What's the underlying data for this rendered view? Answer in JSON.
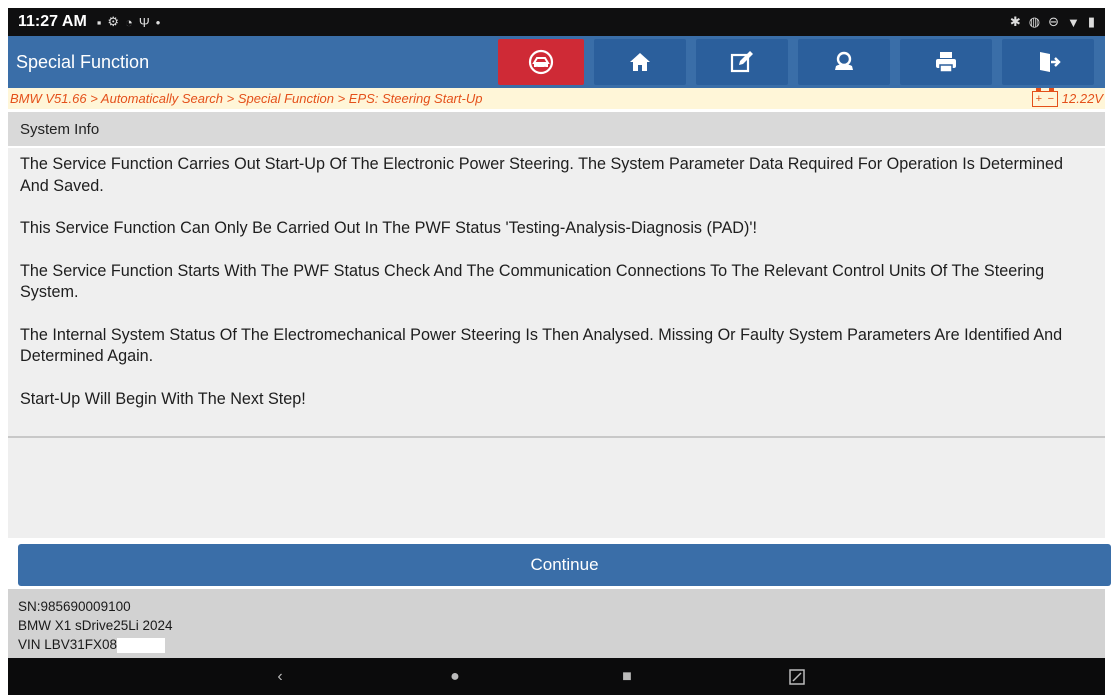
{
  "statusbar": {
    "time": "11:27 AM"
  },
  "titlebar": {
    "title": "Special Function"
  },
  "breadcrumb": {
    "path": "BMW V51.66 > Automatically Search > Special Function > EPS: Steering Start-Up",
    "voltage": "12.22V"
  },
  "section": {
    "header": "System Info"
  },
  "info": {
    "p1": "The Service Function Carries Out Start-Up Of The Electronic Power Steering. The System Parameter Data Required For Operation Is Determined And Saved.",
    "p2": "This Service Function Can Only Be Carried Out In The PWF Status 'Testing-Analysis-Diagnosis (PAD)'!",
    "p3": "The Service Function Starts With The PWF Status Check And The Communication Connections To The Relevant Control Units Of The Steering System.",
    "p4": "The Internal System Status Of The Electromechanical Power Steering Is Then Analysed. Missing Or Faulty System Parameters Are Identified And Determined Again.",
    "p5": "Start-Up Will Begin With The Next Step!"
  },
  "continue_label": "Continue",
  "footer": {
    "sn": "SN:985690009100",
    "vehicle": "BMW X1 sDrive25Li 2024",
    "vin": "VIN LBV31FX08"
  },
  "colors": {
    "accent": "#3a6ea8",
    "alert": "#cf2a36",
    "breadcrumb_text": "#e4501a"
  }
}
